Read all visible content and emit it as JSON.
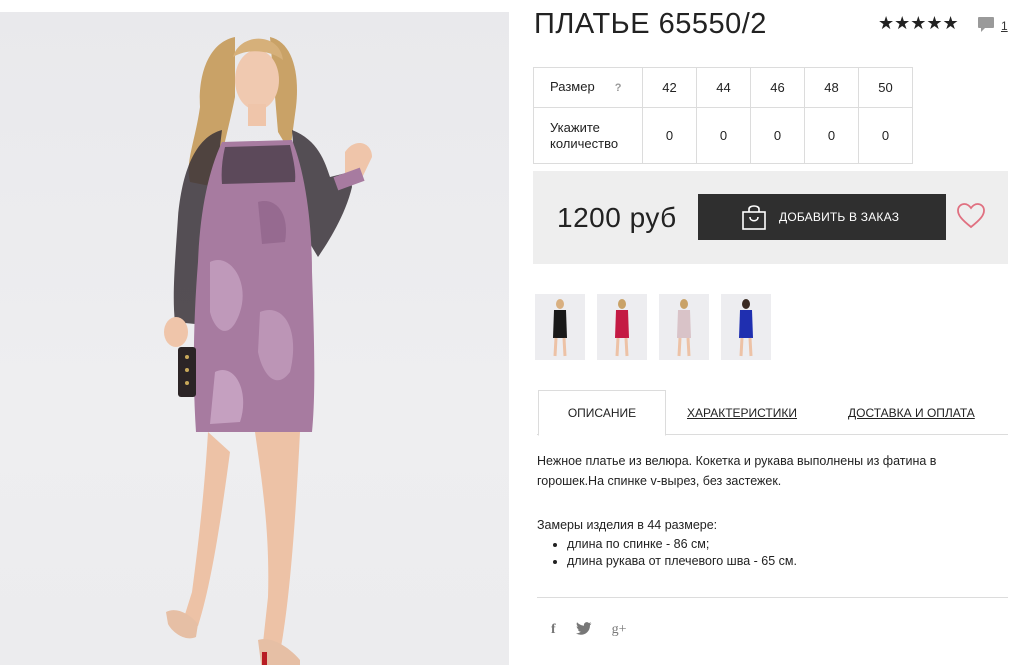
{
  "product": {
    "title": "ПЛАТЬЕ 65550/2",
    "rating_stars": "★★★★★",
    "comments_count": "1"
  },
  "sizes": {
    "size_label": "Размер",
    "help_mark": "?",
    "quantity_label_1": "Укажите",
    "quantity_label_2": "количество",
    "values": [
      "42",
      "44",
      "46",
      "48",
      "50"
    ],
    "quantities": [
      "0",
      "0",
      "0",
      "0",
      "0"
    ]
  },
  "purchase": {
    "price": "1200 руб",
    "add_button": "ДОБАВИТЬ В ЗАКАЗ"
  },
  "thumbnails": [
    {
      "color": "#1a1a1a"
    },
    {
      "color": "#c41a44"
    },
    {
      "color": "#d9c3c8"
    },
    {
      "color": "#1f2fb0"
    }
  ],
  "tabs": {
    "description": "ОПИСАНИЕ",
    "characteristics": "ХАРАКТЕРИСТИКИ",
    "delivery": "ДОСТАВКА И ОПЛАТА"
  },
  "description": {
    "line1": "Нежное платье из велюра. Кокетка и рукава выполнены из фатина в",
    "line2": "горошек.На спинке v-вырез, без застежек.",
    "measurements_title": "Замеры изделия в 44 размере:",
    "items": [
      "длина по спинке - 86 см;",
      "длина рукава от плечевого шва - 65 см."
    ]
  },
  "social": {
    "facebook": "f",
    "twitter": "🐦",
    "googleplus": "g+"
  },
  "colors": {
    "button_bg": "#2f2f2f",
    "heart": "#e07080",
    "dress": "#a77ba0"
  }
}
